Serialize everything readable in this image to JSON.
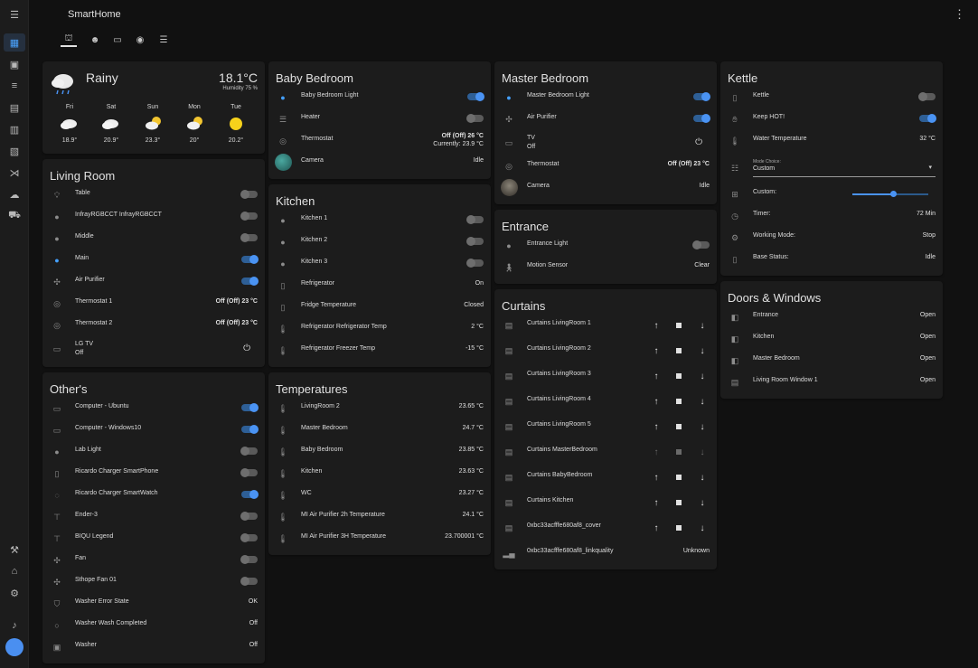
{
  "app": {
    "title": "SmartHome"
  },
  "colors": {
    "accent": "#4a93f3",
    "card": "#1c1c1c",
    "background": "#111111"
  },
  "sidebar": {
    "items": [
      {
        "icon": "dashboard-icon",
        "active": true
      },
      {
        "icon": "map-marker-icon"
      },
      {
        "icon": "list-icon"
      },
      {
        "icon": "chart-icon"
      },
      {
        "icon": "calendar-icon"
      },
      {
        "icon": "list-box-icon"
      },
      {
        "icon": "vscode-icon"
      },
      {
        "icon": "cloud-icon"
      },
      {
        "icon": "car-icon"
      }
    ],
    "bottom": [
      {
        "icon": "hammer-icon"
      },
      {
        "icon": "home-settings-icon"
      },
      {
        "icon": "cog-icon"
      },
      {
        "icon": "bell-icon"
      }
    ]
  },
  "views": [
    {
      "icon": "sofa-icon",
      "active": true
    },
    {
      "icon": "robot-icon"
    },
    {
      "icon": "tv-icon"
    },
    {
      "icon": "media-icon"
    },
    {
      "icon": "server-icon"
    }
  ],
  "weather": {
    "condition": "Rainy",
    "temperature": "18.1°C",
    "humidity": "Humidity 75 %",
    "forecast": [
      {
        "day": "Fri",
        "temp": "18.9°",
        "icon": "cloudy"
      },
      {
        "day": "Sat",
        "temp": "20.9°",
        "icon": "cloudy"
      },
      {
        "day": "Sun",
        "temp": "23.3°",
        "icon": "partly-cloudy"
      },
      {
        "day": "Mon",
        "temp": "20°",
        "icon": "partly-cloudy"
      },
      {
        "day": "Tue",
        "temp": "20.2°",
        "icon": "sunny"
      }
    ]
  },
  "living_room": {
    "title": "Living Room",
    "rows": [
      {
        "name": "Table",
        "toggle": false
      },
      {
        "name": "InfrayRGBCCT InfrayRGBCCT",
        "toggle": false
      },
      {
        "name": "Middle",
        "toggle": false
      },
      {
        "name": "Main",
        "toggle": true
      },
      {
        "name": "Air Purifier",
        "toggle": true
      },
      {
        "name": "Thermostat 1",
        "value": "Off (Off) 23 °C"
      },
      {
        "name": "Thermostat 2",
        "value": "Off (Off) 23 °C"
      },
      {
        "name": "LG TV",
        "sub": "Off"
      }
    ]
  },
  "others": {
    "title": "Other's",
    "rows": [
      {
        "name": "Computer - Ubuntu",
        "toggle": true
      },
      {
        "name": "Computer - Windows10",
        "toggle": true
      },
      {
        "name": "Lab Light",
        "toggle": false
      },
      {
        "name": "Ricardo Charger SmartPhone",
        "toggle": false
      },
      {
        "name": "Ricardo Charger SmartWatch",
        "toggle": true
      },
      {
        "name": "Ender-3",
        "toggle": false
      },
      {
        "name": "BIQU Legend",
        "toggle": false
      },
      {
        "name": "Fan",
        "toggle": false
      },
      {
        "name": "Sthope Fan 01",
        "toggle": false
      },
      {
        "name": "Washer Error State",
        "value": "OK"
      },
      {
        "name": "Washer Wash Completed",
        "value": "Off"
      },
      {
        "name": "Washer",
        "value": "Off"
      }
    ]
  },
  "baby_bedroom": {
    "title": "Baby Bedroom",
    "rows": [
      {
        "name": "Baby Bedroom Light",
        "toggle": true
      },
      {
        "name": "Heater",
        "toggle": false
      },
      {
        "name": "Thermostat",
        "value": "Off (Off) 26 °C",
        "value2": "Currently: 23.9 °C"
      },
      {
        "name": "Camera",
        "value": "Idle"
      }
    ]
  },
  "kitchen": {
    "title": "Kitchen",
    "rows": [
      {
        "name": "Kitchen 1",
        "toggle": false
      },
      {
        "name": "Kitchen 2",
        "toggle": false
      },
      {
        "name": "Kitchen 3",
        "toggle": false
      },
      {
        "name": "Refrigerator",
        "value": "On"
      },
      {
        "name": "Fridge Temperature",
        "value": "Closed"
      },
      {
        "name": "Refrigerator Refrigerator Temp",
        "value": "2 °C"
      },
      {
        "name": "Refrigerator Freezer Temp",
        "value": "-15 °C"
      }
    ]
  },
  "temperatures": {
    "title": "Temperatures",
    "rows": [
      {
        "name": "LivingRoom 2",
        "value": "23.65 °C"
      },
      {
        "name": "Master Bedroom",
        "value": "24.7 °C"
      },
      {
        "name": "Baby Bedroom",
        "value": "23.85 °C"
      },
      {
        "name": "Kitchen",
        "value": "23.63 °C"
      },
      {
        "name": "WC",
        "value": "23.27 °C"
      },
      {
        "name": "MI Air Purifier 2h Temperature",
        "value": "24.1 °C"
      },
      {
        "name": "MI Air Purifier 3H Temperature",
        "value": "23.700001 °C"
      }
    ]
  },
  "master_bedroom": {
    "title": "Master Bedroom",
    "rows": [
      {
        "name": "Master Bedroom Light",
        "toggle": true
      },
      {
        "name": "Air Purifier",
        "toggle": true
      },
      {
        "name": "TV",
        "sub": "Off"
      },
      {
        "name": "Thermostat",
        "value": "Off (Off) 23 °C"
      },
      {
        "name": "Camera",
        "value": "Idle"
      }
    ]
  },
  "entrance": {
    "title": "Entrance",
    "rows": [
      {
        "name": "Entrance Light",
        "toggle": false
      },
      {
        "name": "Motion Sensor",
        "value": "Clear"
      }
    ]
  },
  "curtains": {
    "title": "Curtains",
    "rows": [
      {
        "name": "Curtains LivingRoom 1"
      },
      {
        "name": "Curtains LivingRoom 2"
      },
      {
        "name": "Curtains LivingRoom 3"
      },
      {
        "name": "Curtains LivingRoom 4"
      },
      {
        "name": "Curtains LivingRoom 5"
      },
      {
        "name": "Curtains MasterBedroom",
        "disabled": true
      },
      {
        "name": "Curtains BabyBedroom"
      },
      {
        "name": "Curtains Kitchen"
      },
      {
        "name": "0xbc33acfffe680af8_cover"
      }
    ],
    "last": {
      "name": "0xbc33acfffe680af8_linkquality",
      "value": "Unknown"
    }
  },
  "kettle": {
    "title": "Kettle",
    "rows": [
      {
        "name": "Kettle",
        "toggle": false
      },
      {
        "name": "Keep HOT!",
        "toggle": true
      },
      {
        "name": "Water Temperature",
        "value": "32 °C"
      }
    ],
    "mode": {
      "label": "Mode Choice:",
      "value": "Custom"
    },
    "custom": {
      "name": "Custom:",
      "level": 0.53
    },
    "rest": [
      {
        "name": "Timer:",
        "value": "72 Min"
      },
      {
        "name": "Working Mode:",
        "value": "Stop"
      },
      {
        "name": "Base Status:",
        "value": "Idle"
      }
    ]
  },
  "doors": {
    "title": "Doors & Windows",
    "rows": [
      {
        "name": "Entrance",
        "value": "Open"
      },
      {
        "name": "Kitchen",
        "value": "Open"
      },
      {
        "name": "Master Bedroom",
        "value": "Open"
      },
      {
        "name": "Living Room Window 1",
        "value": "Open"
      }
    ]
  }
}
